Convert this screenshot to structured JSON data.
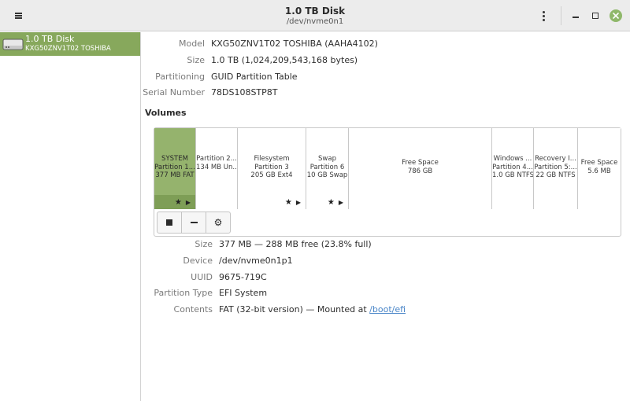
{
  "window": {
    "title": "1.0 TB Disk",
    "subtitle": "/dev/nvme0n1"
  },
  "icons": {
    "menu": "hamburger-menu-icon",
    "kebab": "vertical-dots-icon",
    "minimize": "minimize-icon",
    "maximize": "maximize-icon",
    "close": "close-icon",
    "drive": "hard-drive-icon",
    "star": "star-icon",
    "play": "play-icon",
    "stop": "stop-icon",
    "minus": "minus-icon",
    "gear": "gears-icon"
  },
  "colors": {
    "accent": "#87a85c",
    "selected_partition": "#95b36d",
    "close_button": "#8fb86a",
    "link": "#4a86c8"
  },
  "sidebar": {
    "drive": {
      "name": "1.0 TB Disk",
      "model": "KXG50ZNV1T02 TOSHIBA"
    }
  },
  "disk_info": {
    "model_label": "Model",
    "model": "KXG50ZNV1T02 TOSHIBA (AAHA4102)",
    "size_label": "Size",
    "size": "1.0 TB (1,024,209,543,168 bytes)",
    "partitioning_label": "Partitioning",
    "partitioning": "GUID Partition Table",
    "serial_label": "Serial Number",
    "serial": "78DS108STP8T"
  },
  "volumes": {
    "title": "Volumes",
    "partitions": [
      {
        "line1": "SYSTEM",
        "line2": "Partition 1...",
        "line3": "377 MB FAT",
        "selected": true,
        "flags": "★ ▶"
      },
      {
        "line1": "Partition 2...",
        "line2": "134 MB Un...",
        "line3": "",
        "selected": false,
        "flags": ""
      },
      {
        "line1": "Filesystem",
        "line2": "Partition 3",
        "line3": "205 GB Ext4",
        "selected": false,
        "flags": "★ ▶"
      },
      {
        "line1": "Swap",
        "line2": "Partition 6",
        "line3": "10 GB Swap",
        "selected": false,
        "flags": "★ ▶"
      },
      {
        "line1": "Free Space",
        "line2": "786 GB",
        "line3": "",
        "selected": false,
        "flags": ""
      },
      {
        "line1": "Windows ...",
        "line2": "Partition 4...",
        "line3": "1.0 GB NTFS",
        "selected": false,
        "flags": ""
      },
      {
        "line1": "Recovery I...",
        "line2": "Partition 5:...",
        "line3": "22 GB NTFS",
        "selected": false,
        "flags": ""
      },
      {
        "line1": "Free Space",
        "line2": "5.6 MB",
        "line3": "",
        "selected": false,
        "flags": ""
      }
    ]
  },
  "selected_volume": {
    "size_label": "Size",
    "size": "377 MB — 288 MB free (23.8% full)",
    "device_label": "Device",
    "device": "/dev/nvme0n1p1",
    "uuid_label": "UUID",
    "uuid": "9675-719C",
    "partition_type_label": "Partition Type",
    "partition_type": "EFI System",
    "contents_label": "Contents",
    "contents_prefix": "FAT (32-bit version) — Mounted at ",
    "mount_point": "/boot/efi"
  }
}
